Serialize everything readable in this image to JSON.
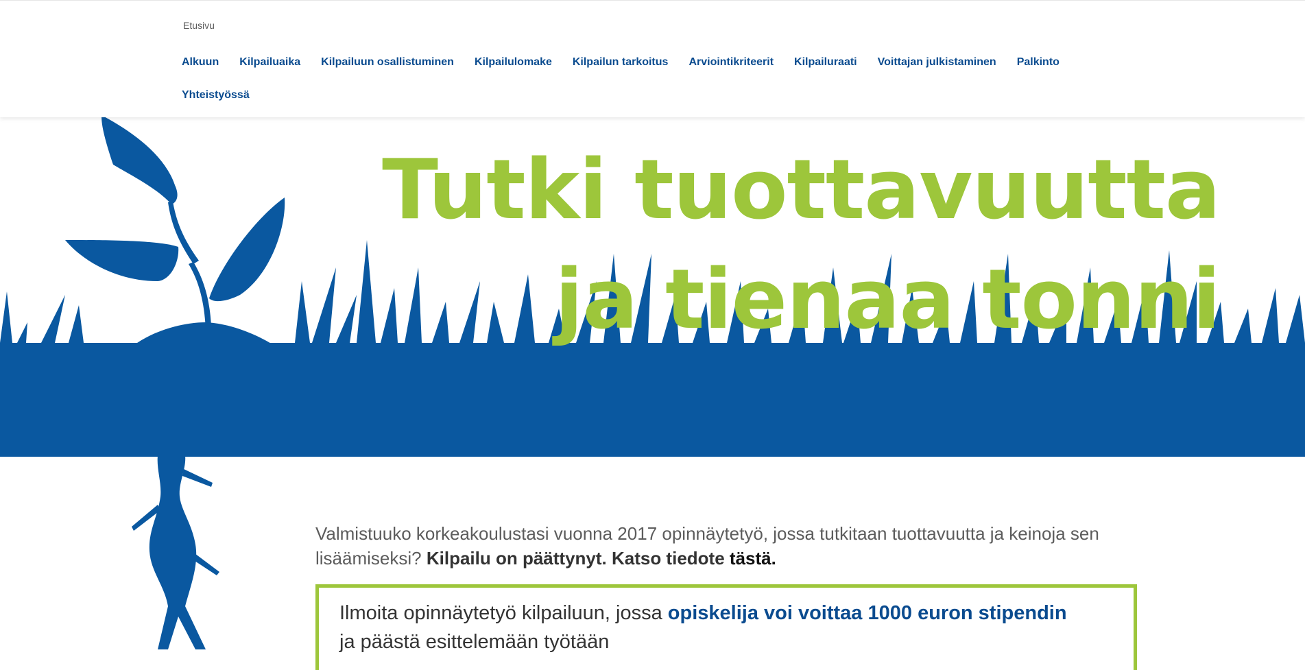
{
  "breadcrumb": {
    "home": "Etusivu"
  },
  "nav": {
    "items": [
      "Alkuun",
      "Kilpailuaika",
      "Kilpailuun osallistuminen",
      "Kilpailulomake",
      "Kilpailun tarkoitus",
      "Arviointikriteerit",
      "Kilpailuraati",
      "Voittajan julkistaminen",
      "Palkinto",
      "Yhteistyössä"
    ]
  },
  "hero": {
    "line1": "Tutki tuottavuutta",
    "line2": "ja tienaa tonni"
  },
  "intro": {
    "text": "Valmistuuko korkeakoulustasi vuonna 2017 opinnäytetyö, jossa tutkitaan tuottavuutta ja keinoja sen lisäämiseksi?",
    "strong": "Kilpailu on päättynyt. Katso tiedote",
    "link": "tästä."
  },
  "callout": {
    "before": "Ilmoita opinnäytetyö kilpailuun, jossa",
    "highlight": "opiskelija voi voittaa 1000 euron stipendin",
    "after": "ja päästä esittelemään työtään"
  },
  "colors": {
    "brand_blue": "#0a58a0",
    "nav_blue": "#0a4b8f",
    "headline_green": "#9dc63b"
  }
}
